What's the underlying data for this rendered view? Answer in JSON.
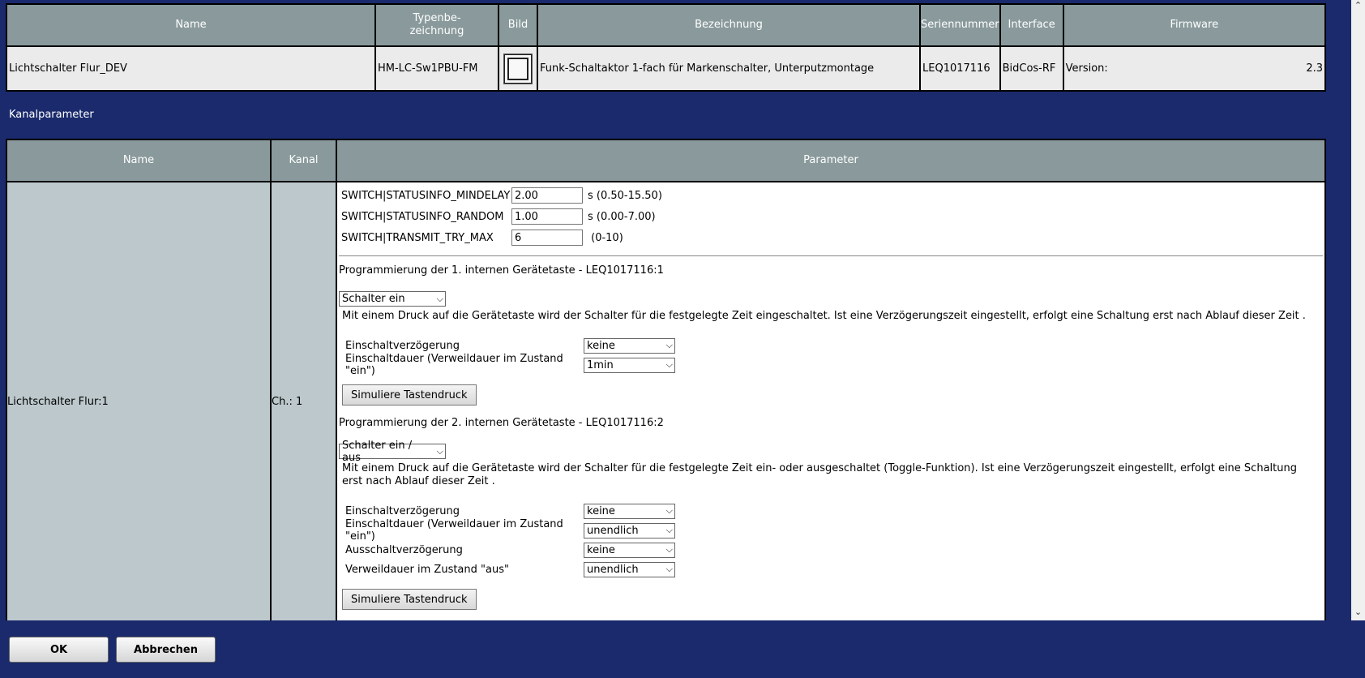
{
  "device_table": {
    "headers": [
      "Name",
      "Typenbe-\nzeichnung",
      "Bild",
      "Bezeichnung",
      "Seriennummer",
      "Interface",
      "Firmware"
    ],
    "row": {
      "name": "Lichtschalter Flur_DEV",
      "type": "HM-LC-Sw1PBU-FM",
      "description": "Funk-Schaltaktor 1-fach für Markenschalter, Unterputzmontage",
      "serial": "LEQ1017116",
      "interface": "BidCos-RF",
      "firmware_label": "Version:",
      "firmware_value": "2.3"
    }
  },
  "section_title": "Kanalparameter",
  "channel_table": {
    "headers": [
      "Name",
      "Kanal",
      "Parameter"
    ],
    "name": "Lichtschalter Flur:1",
    "channel": "Ch.: 1",
    "params": [
      {
        "label": "SWITCH|STATUSINFO_MINDELAY",
        "value": "2.00",
        "unit": "s (0.50-15.50)"
      },
      {
        "label": "SWITCH|STATUSINFO_RANDOM",
        "value": "1.00",
        "unit": "s (0.00-7.00)"
      },
      {
        "label": "SWITCH|TRANSMIT_TRY_MAX",
        "value": "6",
        "unit": " (0-10)"
      }
    ],
    "keys": [
      {
        "title": "Programmierung der 1. internen Gerätetaste - LEQ1017116:1",
        "mode": "Schalter ein",
        "description": "Mit einem Druck auf die Gerätetaste wird der Schalter für die festgelegte Zeit eingeschaltet. Ist eine Verzögerungszeit eingestellt, erfolgt eine Schaltung erst nach Ablauf dieser Zeit .",
        "settings": [
          {
            "label": "Einschaltverzögerung",
            "value": "keine"
          },
          {
            "label": "Einschaltdauer (Verweildauer im Zustand \"ein\")",
            "value": "1min"
          }
        ],
        "button": "Simuliere Tastendruck"
      },
      {
        "title": "Programmierung der 2. internen Gerätetaste - LEQ1017116:2",
        "mode": "Schalter ein / aus",
        "description": "Mit einem Druck auf die Gerätetaste wird der Schalter für die festgelegte Zeit ein- oder ausgeschaltet (Toggle-Funktion). Ist eine Verzögerungszeit eingestellt, erfolgt eine Schaltung erst nach Ablauf dieser Zeit .",
        "settings": [
          {
            "label": "Einschaltverzögerung",
            "value": "keine"
          },
          {
            "label": "Einschaltdauer (Verweildauer im Zustand \"ein\")",
            "value": "unendlich"
          },
          {
            "label": "Ausschaltverzögerung",
            "value": "keine"
          },
          {
            "label": "Verweildauer im Zustand \"aus\"",
            "value": "unendlich"
          }
        ],
        "button": "Simuliere Tastendruck"
      }
    ]
  },
  "footer": {
    "ok": "OK",
    "cancel": "Abbrechen"
  },
  "colors": {
    "background": "#1a2a6c",
    "header": "#8a9a9c",
    "name_cell": "#bcc8cc"
  }
}
